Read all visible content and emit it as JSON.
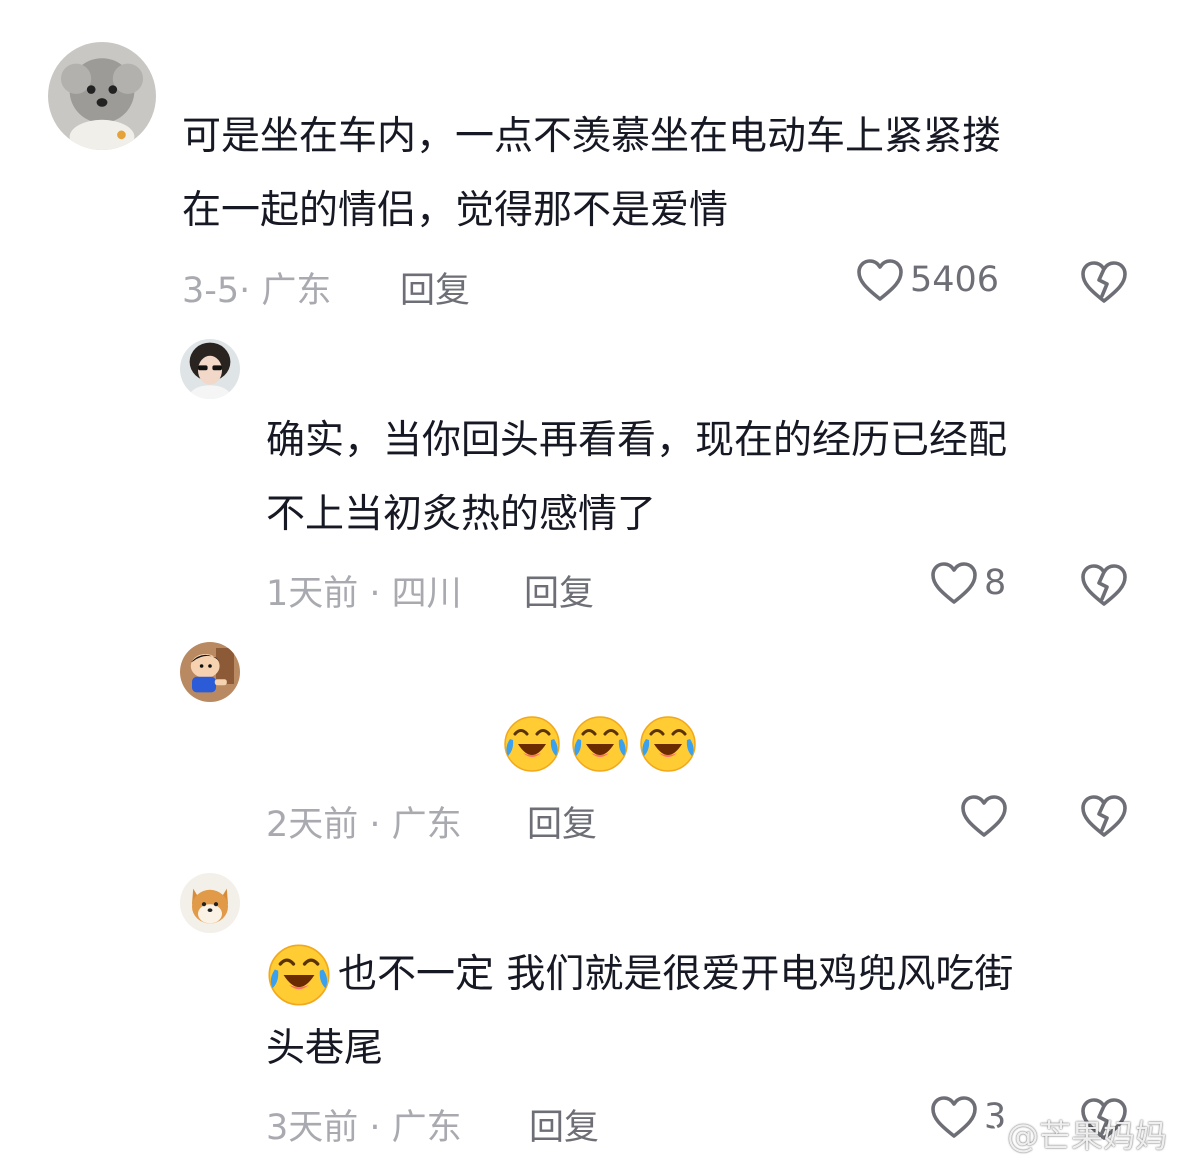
{
  "comments": [
    {
      "text_line1": "可是坐在车内，一点不羡慕坐在电动车上紧紧搂",
      "text_line2": "在一起的情侣，觉得那不是爱情",
      "meta": "3-5· 广东",
      "reply": "回复",
      "likes": "5406"
    },
    {
      "text_line1": "确实，当你回头再看看，现在的经历已经配",
      "text_line2": "不上当初炙热的感情了",
      "meta": "1天前 · 四川",
      "reply": "回复",
      "likes": "8"
    },
    {
      "emoji": [
        "crying-laughing-emoji",
        "crying-laughing-emoji",
        "crying-laughing-emoji"
      ],
      "meta": "2天前 · 广东",
      "reply": "回复",
      "likes": ""
    },
    {
      "text_line1": "也不一定 我们就是很爱开电鸡兜风吃街",
      "text_line2": "头巷尾",
      "meta": "3天前 · 广东",
      "reply": "回复",
      "likes": "3"
    }
  ],
  "watermark": {
    "text": "@芒果妈妈",
    "icon": "weibo-icon"
  },
  "colors": {
    "text": "#161823",
    "meta": "#a9aab0",
    "action": "#6e6f76",
    "emoji_face": "#ffcc33",
    "emoji_tear": "#3aa0f0"
  }
}
